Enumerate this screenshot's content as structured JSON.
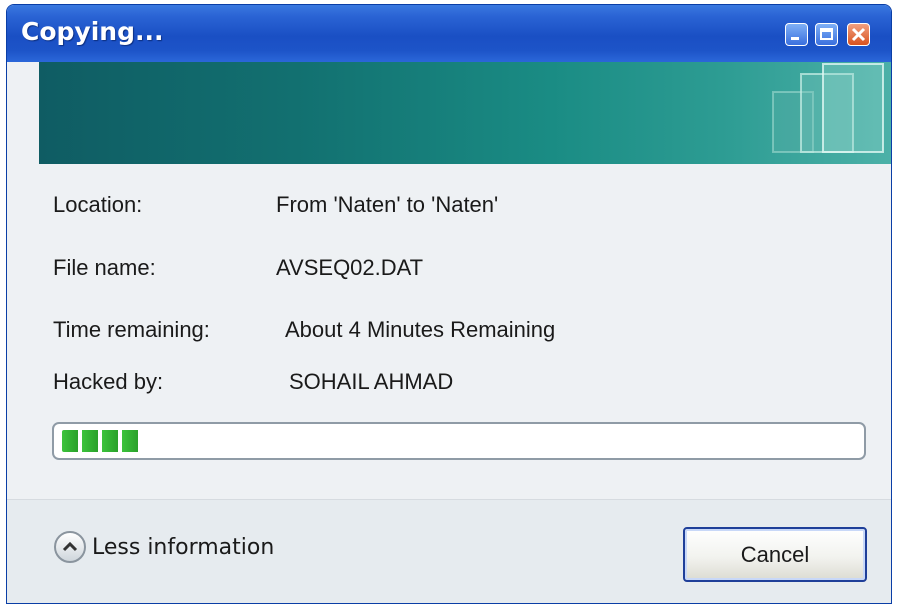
{
  "window": {
    "title": "Copying..."
  },
  "details": {
    "location_label": "Location:",
    "location_value": "From 'Naten' to 'Naten'",
    "file_label": "File name:",
    "file_value": "AVSEQ02.DAT",
    "time_label": "Time remaining:",
    "time_value": "About 4 Minutes Remaining",
    "hacked_label": "Hacked by:",
    "hacked_value": "SOHAIL AHMAD"
  },
  "progress": {
    "percent": 10,
    "color": "#3cc33c"
  },
  "footer": {
    "toggle_label": "Less information",
    "toggle_icon": "chevron-up-icon",
    "cancel_label": "Cancel"
  },
  "colors": {
    "titlebar": "#1a4fc4",
    "banner": "#127070"
  }
}
